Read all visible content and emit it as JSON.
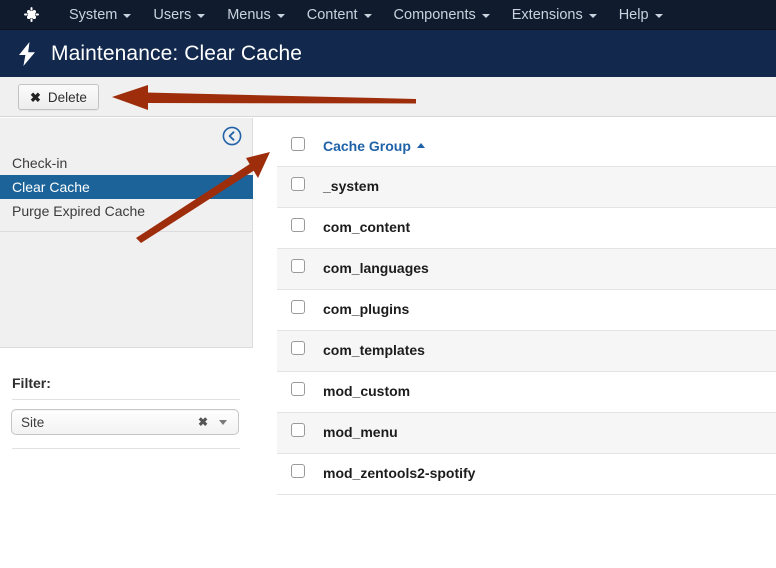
{
  "menubar": {
    "logo_icon": "joomla-logo-icon",
    "items": [
      {
        "label": "System",
        "has_caret": true
      },
      {
        "label": "Users",
        "has_caret": true
      },
      {
        "label": "Menus",
        "has_caret": true
      },
      {
        "label": "Content",
        "has_caret": true
      },
      {
        "label": "Components",
        "has_caret": true
      },
      {
        "label": "Extensions",
        "has_caret": true
      },
      {
        "label": "Help",
        "has_caret": true
      }
    ]
  },
  "titlebar": {
    "icon": "lightning-bolt-icon",
    "title": "Maintenance: Clear Cache"
  },
  "toolbar": {
    "delete_label": "Delete",
    "delete_icon": "x-icon"
  },
  "sidebar": {
    "collapse_icon": "circle-arrow-left-icon",
    "items": [
      {
        "label": "Check-in",
        "active": false
      },
      {
        "label": "Clear Cache",
        "active": true
      },
      {
        "label": "Purge Expired Cache",
        "active": false
      }
    ],
    "filter_label": "Filter:",
    "filter_select": {
      "value": "Site",
      "clear_icon": "x-icon",
      "caret_icon": "chevron-down-icon"
    }
  },
  "table": {
    "columns": [
      "",
      "Cache Group"
    ],
    "sort_column": "Cache Group",
    "sort_direction": "ascending",
    "rows": [
      {
        "name": "_system"
      },
      {
        "name": "com_content"
      },
      {
        "name": "com_languages"
      },
      {
        "name": "com_plugins"
      },
      {
        "name": "com_templates"
      },
      {
        "name": "mod_custom"
      },
      {
        "name": "mod_menu"
      },
      {
        "name": "mod_zentools2-spotify"
      }
    ]
  },
  "annotations": {
    "arrow_color": "#9e2d0b",
    "arrows": [
      {
        "name": "arrow-to-delete-button",
        "points_at": "delete-button"
      },
      {
        "name": "arrow-to-select-all-checkbox",
        "points_at": "select-all-checkbox"
      }
    ]
  },
  "colors": {
    "menubar_bg": "#101b2d",
    "titlebar_bg": "#12294d",
    "toolbar_bg": "#f0f0f0",
    "sidebar_bg": "#f0f0f0",
    "active_item_bg": "#1b6398",
    "link_blue": "#1f62a8",
    "annotation_red": "#9e2d0b"
  }
}
